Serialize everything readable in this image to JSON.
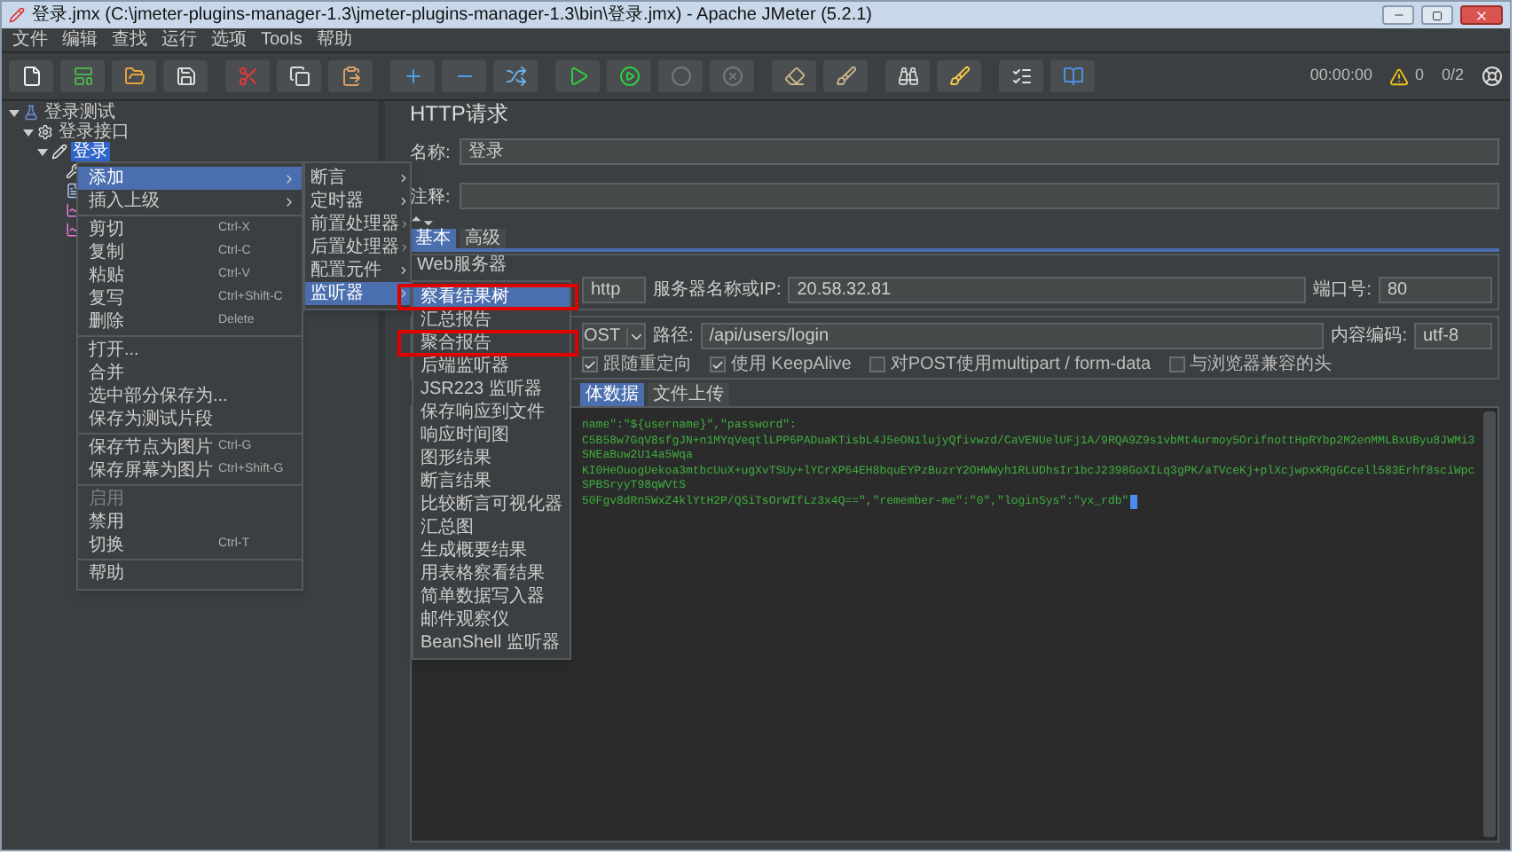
{
  "window": {
    "title": "登录.jmx (C:\\jmeter-plugins-manager-1.3\\jmeter-plugins-manager-1.3\\bin\\登录.jmx) - Apache JMeter (5.2.1)"
  },
  "menu_bar": [
    "文件",
    "编辑",
    "查找",
    "运行",
    "选项",
    "Tools",
    "帮助"
  ],
  "toolbar": {
    "timer": "00:00:00",
    "warnings": "0",
    "threads": "0/2"
  },
  "tree": [
    {
      "label": "登录测试",
      "kind": "plan",
      "expanded": true,
      "selected": false,
      "children": [
        {
          "label": "登录接口",
          "kind": "group",
          "expanded": true,
          "selected": false,
          "children": [
            {
              "label": "登录",
              "kind": "sampler",
              "expanded": true,
              "selected": true,
              "children": [
                {
                  "kind": "tool"
                },
                {
                  "kind": "doc"
                },
                {
                  "kind": "graph"
                },
                {
                  "kind": "graph"
                }
              ]
            }
          ]
        }
      ]
    }
  ],
  "context_menu": {
    "items": [
      {
        "kind": "item",
        "label": "添加",
        "submenu": true,
        "selected": true,
        "disabled": false
      },
      {
        "kind": "item",
        "label": "插入上级",
        "submenu": true,
        "selected": false,
        "disabled": false
      },
      {
        "kind": "separator"
      },
      {
        "kind": "item",
        "label": "剪切",
        "shortcut": "Ctrl-X",
        "submenu": false,
        "selected": false,
        "disabled": false
      },
      {
        "kind": "item",
        "label": "复制",
        "shortcut": "Ctrl-C",
        "submenu": false,
        "selected": false,
        "disabled": false
      },
      {
        "kind": "item",
        "label": "粘贴",
        "shortcut": "Ctrl-V",
        "submenu": false,
        "selected": false,
        "disabled": false
      },
      {
        "kind": "item",
        "label": "复写",
        "shortcut": "Ctrl+Shift-C",
        "submenu": false,
        "selected": false,
        "disabled": false
      },
      {
        "kind": "item",
        "label": "删除",
        "shortcut": "Delete",
        "submenu": false,
        "selected": false,
        "disabled": false
      },
      {
        "kind": "separator"
      },
      {
        "kind": "item",
        "label": "打开...",
        "submenu": false,
        "selected": false,
        "disabled": false
      },
      {
        "kind": "item",
        "label": "合并",
        "submenu": false,
        "selected": false,
        "disabled": false
      },
      {
        "kind": "item",
        "label": "选中部分保存为...",
        "submenu": false,
        "selected": false,
        "disabled": false
      },
      {
        "kind": "item",
        "label": "保存为测试片段",
        "submenu": false,
        "selected": false,
        "disabled": false
      },
      {
        "kind": "separator"
      },
      {
        "kind": "item",
        "label": "保存节点为图片",
        "shortcut": "Ctrl-G",
        "submenu": false,
        "selected": false,
        "disabled": false
      },
      {
        "kind": "item",
        "label": "保存屏幕为图片",
        "shortcut": "Ctrl+Shift-G",
        "submenu": false,
        "selected": false,
        "disabled": false
      },
      {
        "kind": "separator"
      },
      {
        "kind": "item",
        "label": "启用",
        "submenu": false,
        "selected": false,
        "disabled": true
      },
      {
        "kind": "item",
        "label": "禁用",
        "submenu": false,
        "selected": false,
        "disabled": false
      },
      {
        "kind": "item",
        "label": "切换",
        "shortcut": "Ctrl-T",
        "submenu": false,
        "selected": false,
        "disabled": false
      },
      {
        "kind": "separator"
      },
      {
        "kind": "item",
        "label": "帮助",
        "submenu": false,
        "selected": false,
        "disabled": false
      }
    ]
  },
  "add_menu": {
    "items": [
      {
        "label": "断言",
        "selected": false
      },
      {
        "label": "定时器",
        "selected": false
      },
      {
        "label": "前置处理器",
        "selected": false
      },
      {
        "label": "后置处理器",
        "selected": false
      },
      {
        "label": "配置元件",
        "selected": false
      },
      {
        "label": "监听器",
        "selected": true
      }
    ]
  },
  "listener_menu": {
    "items": [
      {
        "label": "察看结果树",
        "selected": true,
        "annotated": true
      },
      {
        "label": "汇总报告",
        "selected": false,
        "annotated": false
      },
      {
        "label": "聚合报告",
        "selected": false,
        "annotated": true
      },
      {
        "label": "后端监听器",
        "selected": false,
        "annotated": false
      },
      {
        "label": "JSR223 监听器",
        "selected": false,
        "annotated": false
      },
      {
        "label": "保存响应到文件",
        "selected": false,
        "annotated": false
      },
      {
        "label": "响应时间图",
        "selected": false,
        "annotated": false
      },
      {
        "label": "图形结果",
        "selected": false,
        "annotated": false
      },
      {
        "label": "断言结果",
        "selected": false,
        "annotated": false
      },
      {
        "label": "比较断言可视化器",
        "selected": false,
        "annotated": false
      },
      {
        "label": "汇总图",
        "selected": false,
        "annotated": false
      },
      {
        "label": "生成概要结果",
        "selected": false,
        "annotated": false
      },
      {
        "label": "用表格察看结果",
        "selected": false,
        "annotated": false
      },
      {
        "label": "简单数据写入器",
        "selected": false,
        "annotated": false
      },
      {
        "label": "邮件观察仪",
        "selected": false,
        "annotated": false
      },
      {
        "label": "BeanShell 监听器",
        "selected": false,
        "annotated": false
      }
    ]
  },
  "http_request": {
    "title": "HTTP请求",
    "name_label": "名称:",
    "name": "登录",
    "comment_label": "注释:",
    "tabs": [
      {
        "label": "基本",
        "selected": true
      },
      {
        "label": "高级",
        "selected": false
      }
    ],
    "web_server": {
      "title": "Web服务器",
      "protocol": "http",
      "server_label": "服务器名称或IP:",
      "server": "20.58.32.81",
      "port_label": "端口号:",
      "port": "80"
    },
    "method": "OST",
    "path_label": "路径:",
    "path": "/api/users/login",
    "encoding_label": "内容编码:",
    "encoding": "utf-8",
    "options": [
      {
        "label": "跟随重定向",
        "checked": true
      },
      {
        "label": "使用 KeepAlive",
        "checked": true
      },
      {
        "label": "对POST使用multipart / form-data",
        "checked": false
      },
      {
        "label": "与浏览器兼容的头",
        "checked": false
      }
    ],
    "body_tabs": [
      {
        "label": "体数据",
        "selected": true
      },
      {
        "label": "文件上传",
        "selected": false
      }
    ],
    "body_lines": [
      "name\":\"${username}\",\"password\":",
      "C5B58w7GqV8sfgJN+n1MYqVeqtlLPP6PADuaKTisbL4J5eON1lujyQfivwzd/CaVENUelUFj1A/9RQA9Z9s1vbMt4urmoy5OrifnottHpRYbp2M2enMMLBxUByu8JWMi3SNEaBuw2U14a5Wqa",
      "KI0HeOuogUekoa3mtbcUuX+ugXvTSUy+lYCrXP64EH8bquEYPzBuzrY2OHWWyh1RLUDhsIr1bcJ2398GoXILq3gPK/aTVceKj+plXcjwpxKRgGCcell583Erhf8sciWpcSPBSryyT98qWVtS",
      "50Fgv8dRn5WxZ4klYtH2P/QSiTsOrWIfLz3x4Q==\",\"remember-me\":\"0\",\"loginSys\":\"yx_rdb\""
    ]
  }
}
